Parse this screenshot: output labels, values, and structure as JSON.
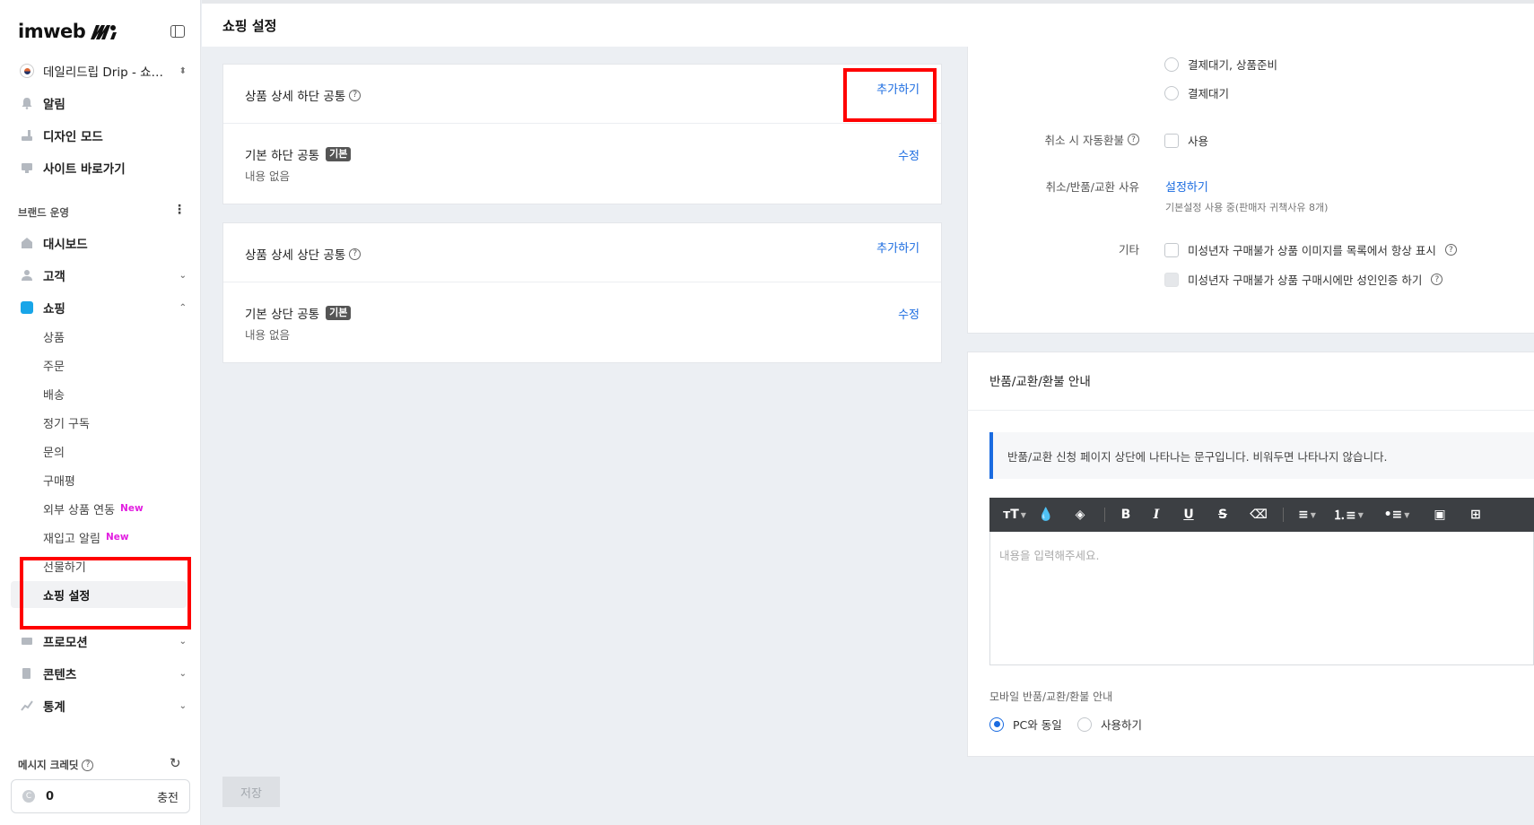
{
  "sidebar": {
    "logo": "imweb",
    "site_name": "데일리드립 Drip - 쇼…",
    "top_items": [
      {
        "label": "알림",
        "icon": "bell-icon"
      },
      {
        "label": "디자인 모드",
        "icon": "brush-icon"
      },
      {
        "label": "사이트 바로가기",
        "icon": "monitor-icon"
      }
    ],
    "section_label": "브랜드 운영",
    "nav": {
      "dashboard": "대시보드",
      "customer": "고객",
      "shopping": "쇼핑",
      "promotion": "프로모션",
      "contents": "콘텐츠",
      "stats": "통계"
    },
    "shopping_sub": [
      {
        "label": "상품",
        "new": ""
      },
      {
        "label": "주문",
        "new": ""
      },
      {
        "label": "배송",
        "new": ""
      },
      {
        "label": "정기 구독",
        "new": ""
      },
      {
        "label": "문의",
        "new": ""
      },
      {
        "label": "구매평",
        "new": ""
      },
      {
        "label": "외부 상품 연동",
        "new": "New"
      },
      {
        "label": "재입고 알림",
        "new": "New"
      },
      {
        "label": "선물하기",
        "new": ""
      },
      {
        "label": "쇼핑 설정",
        "new": ""
      }
    ],
    "credit_label": "메시지 크레딧",
    "credit_value": "0",
    "charge_label": "충전"
  },
  "header": {
    "title": "쇼핑 설정"
  },
  "left_cards": {
    "bottom_common": {
      "title": "상품 상세 하단 공통",
      "add_label": "추가하기",
      "item_title": "기본 하단 공통",
      "badge": "기본",
      "item_sub": "내용 없음",
      "edit_label": "수정"
    },
    "top_common": {
      "title": "상품 상세 상단 공통",
      "add_label": "추가하기",
      "item_title": "기본 상단 공통",
      "badge": "기본",
      "item_sub": "내용 없음",
      "edit_label": "수정"
    },
    "save_label": "저장"
  },
  "right_panel": {
    "status_options": [
      "결제대기, 상품준비",
      "결제대기"
    ],
    "auto_refund_label": "취소 시 자동환불",
    "auto_refund_option": "사용",
    "reason_label": "취소/반품/교환 사유",
    "reason_link": "설정하기",
    "reason_note": "기본설정 사용 중(판매자 귀책사유 8개)",
    "etc_label": "기타",
    "etc_options": [
      "미성년자 구매불가 상품 이미지를 목록에서 항상 표시",
      "미성년자 구매불가 상품 구매시에만 성인인증 하기"
    ],
    "return_guide_title": "반품/교환/환불 안내",
    "info_text": "반품/교환 신청 페이지 상단에 나타나는 문구입니다. 비워두면 나타나지 않습니다.",
    "editor_placeholder": "내용을 입력해주세요.",
    "mobile_label": "모바일 반품/교환/환불 안내",
    "mobile_options": [
      "PC와 동일",
      "사용하기"
    ]
  },
  "colors": {
    "accent": "#1a6be0",
    "highlight_box": "#ff0000",
    "new_badge": "#e21ee0"
  }
}
